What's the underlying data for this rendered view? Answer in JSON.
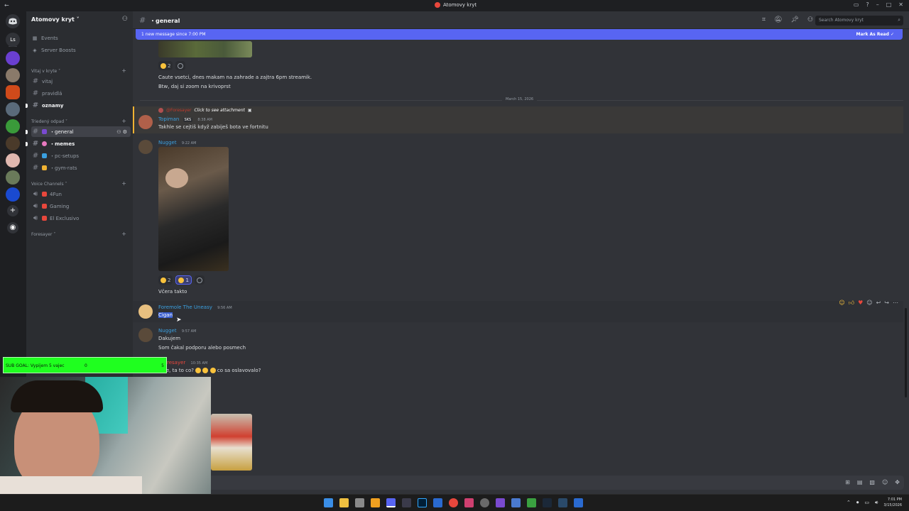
{
  "window": {
    "title": "Atomovy kryt"
  },
  "server": {
    "name": "Atomovy kryt ˅"
  },
  "rail": {
    "home_label": "Ls"
  },
  "sidebar": {
    "events_label": "Events",
    "boosts_label": "Server Boosts",
    "categories": [
      {
        "name": "Vitaj v kryte ˅"
      },
      {
        "name": "Triedený odpad ˅"
      },
      {
        "name": "Voice Channels ˅"
      },
      {
        "name": "Foresayer ˅"
      }
    ],
    "text_channels": [
      {
        "name": "vitaj"
      },
      {
        "name": "pravidlá"
      },
      {
        "name": "oznamy"
      },
      {
        "name": "・general"
      },
      {
        "name": "・memes"
      },
      {
        "name": "・pc-setups"
      },
      {
        "name": "・gym-rats"
      }
    ],
    "voice_channels": [
      {
        "name": "4Fun"
      },
      {
        "name": "Gaming"
      },
      {
        "name": "El Exclusivo"
      }
    ]
  },
  "header": {
    "channel": "・general",
    "search_placeholder": "Search Atomovy kryt"
  },
  "banner": {
    "text": "1 new message since 7:00 PM",
    "action": "Mark As Read"
  },
  "messages": {
    "first": {
      "reaction_count": "2",
      "line1": "Caute vsetci, dnes makam na zahrade a zajtra 6pm streamik.",
      "line2": "Btw, daj si zoom na krivoprst"
    },
    "date_divider": "March 15, 2026",
    "topiman": {
      "reply_name": "@Foresayer",
      "reply_text": "Click to see attachment",
      "author": "Topiman",
      "tag": "SKS",
      "time": "8:38 AM",
      "text": "Takhle se cejtiš když zabiješ bota ve fortnitu"
    },
    "nugget1": {
      "author": "Nugget",
      "time": "9:22 AM",
      "reaction1_count": "2",
      "reaction2_count": "1",
      "text": "Včera takto"
    },
    "foremole": {
      "author": "Foremole The Uneasy",
      "time": "9:56 AM",
      "text": "Cigan"
    },
    "nugget2": {
      "author": "Nugget",
      "time": "9:57 AM",
      "line1": "Dakujem",
      "line2": "Som čakal podporu alebo posmech"
    },
    "foresayer": {
      "author": "resayer",
      "time": "10:35 AM",
      "text_start": "ggie, ta to co?",
      "text_end": "co sa oslavovalo?"
    }
  },
  "overlay": {
    "goal_label": "SUB GOAL: Vypijem 5 vajec",
    "goal_current": "0",
    "goal_target": "5"
  },
  "taskbar": {
    "time": "7:01 PM",
    "date": "3/15/2026"
  }
}
